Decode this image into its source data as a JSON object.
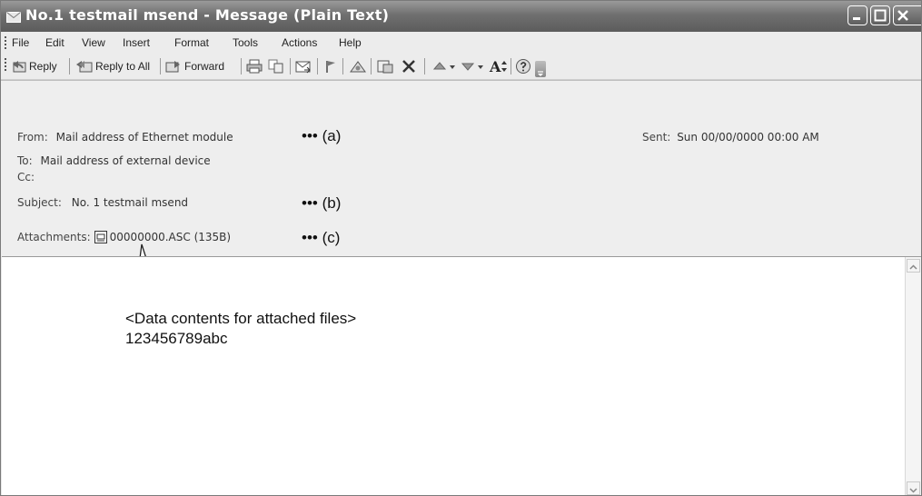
{
  "window": {
    "title": "No.1 testmail msend - Message (Plain Text)"
  },
  "menu": {
    "items": [
      "File",
      "Edit",
      "View",
      "Insert",
      "Format",
      "Tools",
      "Actions",
      "Help"
    ]
  },
  "toolbar": {
    "reply": "Reply",
    "reply_all": "Reply to All",
    "forward": "Forward",
    "font_size_glyph": "A",
    "icons": [
      "reply-icon",
      "reply-all-icon",
      "forward-icon",
      "print-icon",
      "copy-icon",
      "move-icon",
      "flag-icon",
      "categorize-icon",
      "move-to-folder-icon",
      "delete-icon",
      "previous-item-icon",
      "next-item-icon",
      "font-size-icon",
      "help-icon",
      "toolbar-options-icon"
    ]
  },
  "header": {
    "from_label": "From:",
    "from_value": "Mail address of Ethernet module",
    "to_label": "To:",
    "to_value": "Mail address of external device",
    "cc_label": "Cc:",
    "subject_label": "Subject:",
    "subject_value": "No. 1 testmail msend",
    "attachments_label": "Attachments:",
    "attachment_name": "00000000.ASC (135B)",
    "sent_label": "Sent:",
    "sent_value": "Sun 00/00/0000 00:00 AM"
  },
  "annotations": {
    "a": "••• (a)",
    "b": "••• (b)",
    "c": "••• (c)"
  },
  "callout": {
    "line1": "<Data contents for attached files>",
    "line2": "123456789abc"
  }
}
